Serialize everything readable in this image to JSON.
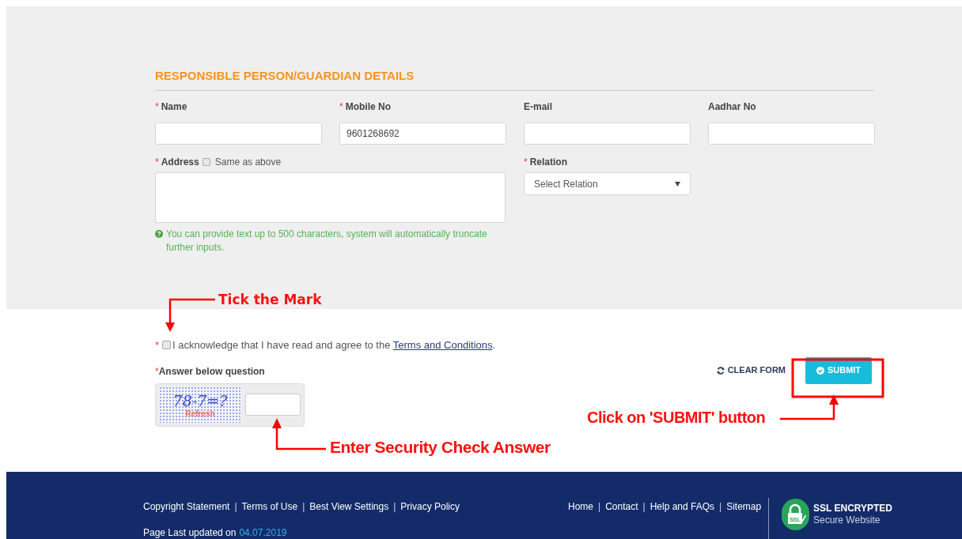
{
  "section": {
    "title": "RESPONSIBLE PERSON/GUARDIAN DETAILS"
  },
  "fields": [
    {
      "kind": "text",
      "label": "Name",
      "mark": "*"
    },
    {
      "kind": "text",
      "label": "Mobile No",
      "mark": "*",
      "value": "9601268692"
    },
    {
      "kind": "text",
      "label": "E-mail"
    },
    {
      "kind": "text",
      "label": "Aadhar No"
    },
    {
      "kind": "textarea",
      "label": "Address",
      "mark": "*",
      "same_as_above": {
        "label": "Same as above",
        "checked": false
      },
      "hint": "You can provide text up to 500 characters, system will automatically truncate further inputs."
    },
    {
      "kind": "select",
      "label": "Relation",
      "mark": "*",
      "placeholder": "Select Relation"
    }
  ],
  "agreement": {
    "mark": "*",
    "checked": false,
    "text": "I acknowledge that I have read and agree to the",
    "link": "Terms and Conditions",
    "end": "."
  },
  "captcha": {
    "mark": "*",
    "label": "Answer below question",
    "question": "78-7=?",
    "refresh": "Refresh"
  },
  "actions": {
    "clear": "CLEAR FORM",
    "submit": "SUBMIT"
  },
  "footer": {
    "links_left": [
      "Copyright Statement",
      "Terms of Use",
      "Best View Settings",
      "Privacy Policy"
    ],
    "links_right": [
      "Home",
      "Contact",
      "Help and FAQs",
      "Sitemap"
    ],
    "separator": "|",
    "updated": {
      "text": "Page Last updated on",
      "date": "04.07.2019"
    },
    "ssl": {
      "title": "SSL ENCRYPTED",
      "subtitle": "Secure Website",
      "badge": "SSL"
    }
  },
  "annotations": [
    {
      "kind": "tick",
      "text": "Tick the Mark"
    },
    {
      "kind": "captcha",
      "text": "Enter Security Check Answer"
    },
    {
      "kind": "submit",
      "text": "Click on 'SUBMIT' button"
    }
  ]
}
